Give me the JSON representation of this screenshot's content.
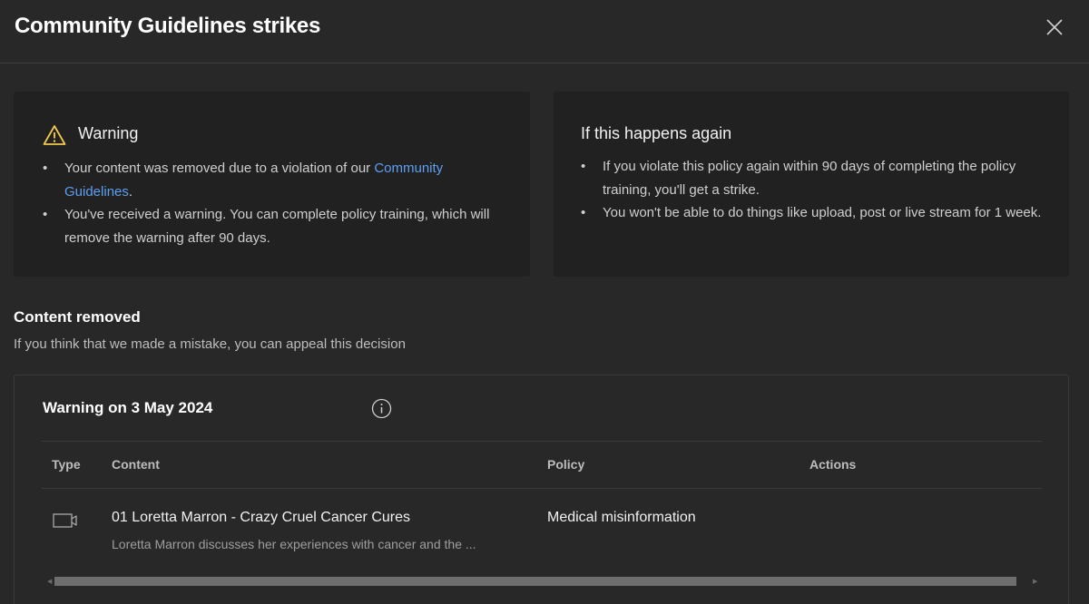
{
  "dialog": {
    "title": "Community Guidelines strikes"
  },
  "warning_card": {
    "heading": "Warning",
    "bullet1_text": "Your content was removed due to a violation of our ",
    "bullet1_link": "Community Guidelines",
    "bullet1_end": ".",
    "bullet2": "You've received a warning. You can complete policy training, which will remove the warning after 90 days."
  },
  "again_card": {
    "heading": "If this happens again",
    "bullet1": "If you violate this policy again within 90 days of completing the policy training, you'll get a strike.",
    "bullet2": "You won't be able to do things like upload, post or live stream for 1 week."
  },
  "content_removed": {
    "title": "Content removed",
    "subtitle": "If you think that we made a mistake, you can appeal this decision"
  },
  "strike_table": {
    "title": "Warning on 3 May 2024",
    "columns": [
      "Type",
      "Content",
      "Policy",
      "Actions"
    ],
    "rows": [
      {
        "type_icon": "video-icon",
        "content_title": "01 Loretta Marron - Crazy Cruel Cancer Cures",
        "content_desc": "Loretta Marron discusses her experiences with cancer and the ...",
        "policy": "Medical misinformation",
        "actions": ""
      }
    ]
  },
  "colors": {
    "background": "#282828",
    "card": "#212121",
    "link": "#5d9ff0",
    "warning_icon": "#f2c94c"
  }
}
